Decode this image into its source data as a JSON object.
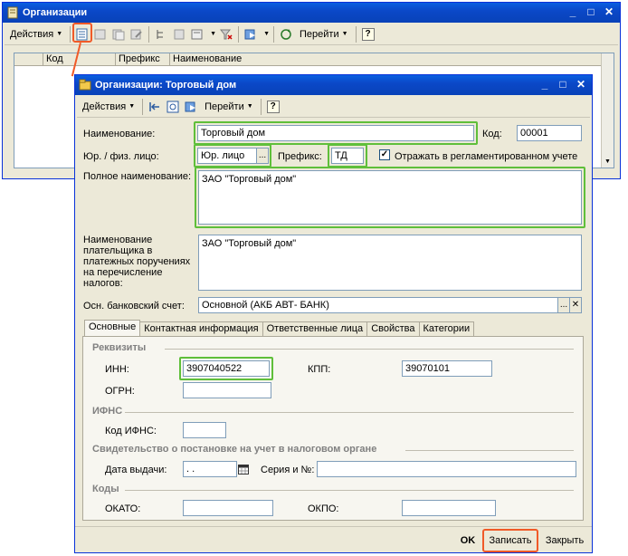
{
  "list_window": {
    "title": "Организации",
    "toolbar": {
      "actions_label": "Действия",
      "goto_label": "Перейти",
      "help_label": "?"
    },
    "columns": [
      "",
      "Код",
      "Префикс",
      "Наименование"
    ]
  },
  "dialog": {
    "title": "Организации: Торговый дом",
    "toolbar": {
      "actions_label": "Действия",
      "goto_label": "Перейти",
      "help_label": "?"
    },
    "fields": {
      "name_label": "Наименование:",
      "name_value": "Торговый дом",
      "code_label": "Код:",
      "code_value": "00001",
      "entity_type_label": "Юр. / физ. лицо:",
      "entity_type_value": "Юр. лицо",
      "prefix_label": "Префикс:",
      "prefix_value": "ТД",
      "reflect_label": "Отражать в регламентированном учете",
      "reflect_checked": true,
      "full_name_label": "Полное наименование:",
      "full_name_value": "ЗАО \"Торговый дом\"",
      "payer_name_label": "Наименование плательщика в платежных поручениях на перечисление налогов:",
      "payer_name_value": "ЗАО \"Торговый дом\"",
      "bank_account_label": "Осн. банковский счет:",
      "bank_account_value": "Основной  (АКБ АВТ- БАНК)"
    },
    "tabs": [
      "Основные",
      "Контактная информация",
      "Ответственные лица",
      "Свойства",
      "Категории"
    ],
    "active_tab": "Основные",
    "sections": {
      "details_title": "Реквизиты",
      "inn_label": "ИНН:",
      "inn_value": "3907040522",
      "kpp_label": "КПП:",
      "kpp_value": "39070101",
      "ogrn_label": "ОГРН:",
      "ogrn_value": "",
      "ifns_title": "ИФНС",
      "ifns_code_label": "Код ИФНС:",
      "ifns_code_value": "",
      "cert_title": "Свидетельство о постановке на учет в налоговом органе",
      "issue_date_label": "Дата выдачи:",
      "issue_date_value": " .  .",
      "cert_series_label": "Серия и №:",
      "cert_series_value": "",
      "codes_title": "Коды",
      "okato_label": "ОКАТО:",
      "okato_value": "",
      "okpo_label": "ОКПО:",
      "okpo_value": ""
    },
    "buttons": {
      "ok": "OK",
      "save": "Записать",
      "close": "Закрыть"
    }
  },
  "colors": {
    "highlight_green": "#5fbf3a",
    "highlight_red": "#f05a28",
    "titlebar": "#0a5fe0"
  }
}
